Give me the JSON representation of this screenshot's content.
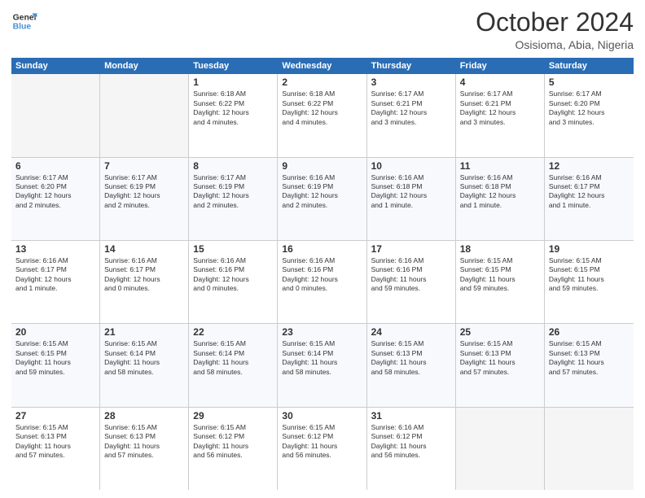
{
  "header": {
    "logo_line1": "General",
    "logo_line2": "Blue",
    "month": "October 2024",
    "location": "Osisioma, Abia, Nigeria"
  },
  "weekdays": [
    "Sunday",
    "Monday",
    "Tuesday",
    "Wednesday",
    "Thursday",
    "Friday",
    "Saturday"
  ],
  "rows": [
    [
      {
        "day": "",
        "info": "",
        "empty": true
      },
      {
        "day": "",
        "info": "",
        "empty": true
      },
      {
        "day": "1",
        "info": "Sunrise: 6:18 AM\nSunset: 6:22 PM\nDaylight: 12 hours\nand 4 minutes."
      },
      {
        "day": "2",
        "info": "Sunrise: 6:18 AM\nSunset: 6:22 PM\nDaylight: 12 hours\nand 4 minutes."
      },
      {
        "day": "3",
        "info": "Sunrise: 6:17 AM\nSunset: 6:21 PM\nDaylight: 12 hours\nand 3 minutes."
      },
      {
        "day": "4",
        "info": "Sunrise: 6:17 AM\nSunset: 6:21 PM\nDaylight: 12 hours\nand 3 minutes."
      },
      {
        "day": "5",
        "info": "Sunrise: 6:17 AM\nSunset: 6:20 PM\nDaylight: 12 hours\nand 3 minutes."
      }
    ],
    [
      {
        "day": "6",
        "info": "Sunrise: 6:17 AM\nSunset: 6:20 PM\nDaylight: 12 hours\nand 2 minutes."
      },
      {
        "day": "7",
        "info": "Sunrise: 6:17 AM\nSunset: 6:19 PM\nDaylight: 12 hours\nand 2 minutes."
      },
      {
        "day": "8",
        "info": "Sunrise: 6:17 AM\nSunset: 6:19 PM\nDaylight: 12 hours\nand 2 minutes."
      },
      {
        "day": "9",
        "info": "Sunrise: 6:16 AM\nSunset: 6:19 PM\nDaylight: 12 hours\nand 2 minutes."
      },
      {
        "day": "10",
        "info": "Sunrise: 6:16 AM\nSunset: 6:18 PM\nDaylight: 12 hours\nand 1 minute."
      },
      {
        "day": "11",
        "info": "Sunrise: 6:16 AM\nSunset: 6:18 PM\nDaylight: 12 hours\nand 1 minute."
      },
      {
        "day": "12",
        "info": "Sunrise: 6:16 AM\nSunset: 6:17 PM\nDaylight: 12 hours\nand 1 minute."
      }
    ],
    [
      {
        "day": "13",
        "info": "Sunrise: 6:16 AM\nSunset: 6:17 PM\nDaylight: 12 hours\nand 1 minute."
      },
      {
        "day": "14",
        "info": "Sunrise: 6:16 AM\nSunset: 6:17 PM\nDaylight: 12 hours\nand 0 minutes."
      },
      {
        "day": "15",
        "info": "Sunrise: 6:16 AM\nSunset: 6:16 PM\nDaylight: 12 hours\nand 0 minutes."
      },
      {
        "day": "16",
        "info": "Sunrise: 6:16 AM\nSunset: 6:16 PM\nDaylight: 12 hours\nand 0 minutes."
      },
      {
        "day": "17",
        "info": "Sunrise: 6:16 AM\nSunset: 6:16 PM\nDaylight: 11 hours\nand 59 minutes."
      },
      {
        "day": "18",
        "info": "Sunrise: 6:15 AM\nSunset: 6:15 PM\nDaylight: 11 hours\nand 59 minutes."
      },
      {
        "day": "19",
        "info": "Sunrise: 6:15 AM\nSunset: 6:15 PM\nDaylight: 11 hours\nand 59 minutes."
      }
    ],
    [
      {
        "day": "20",
        "info": "Sunrise: 6:15 AM\nSunset: 6:15 PM\nDaylight: 11 hours\nand 59 minutes."
      },
      {
        "day": "21",
        "info": "Sunrise: 6:15 AM\nSunset: 6:14 PM\nDaylight: 11 hours\nand 58 minutes."
      },
      {
        "day": "22",
        "info": "Sunrise: 6:15 AM\nSunset: 6:14 PM\nDaylight: 11 hours\nand 58 minutes."
      },
      {
        "day": "23",
        "info": "Sunrise: 6:15 AM\nSunset: 6:14 PM\nDaylight: 11 hours\nand 58 minutes."
      },
      {
        "day": "24",
        "info": "Sunrise: 6:15 AM\nSunset: 6:13 PM\nDaylight: 11 hours\nand 58 minutes."
      },
      {
        "day": "25",
        "info": "Sunrise: 6:15 AM\nSunset: 6:13 PM\nDaylight: 11 hours\nand 57 minutes."
      },
      {
        "day": "26",
        "info": "Sunrise: 6:15 AM\nSunset: 6:13 PM\nDaylight: 11 hours\nand 57 minutes."
      }
    ],
    [
      {
        "day": "27",
        "info": "Sunrise: 6:15 AM\nSunset: 6:13 PM\nDaylight: 11 hours\nand 57 minutes."
      },
      {
        "day": "28",
        "info": "Sunrise: 6:15 AM\nSunset: 6:13 PM\nDaylight: 11 hours\nand 57 minutes."
      },
      {
        "day": "29",
        "info": "Sunrise: 6:15 AM\nSunset: 6:12 PM\nDaylight: 11 hours\nand 56 minutes."
      },
      {
        "day": "30",
        "info": "Sunrise: 6:15 AM\nSunset: 6:12 PM\nDaylight: 11 hours\nand 56 minutes."
      },
      {
        "day": "31",
        "info": "Sunrise: 6:16 AM\nSunset: 6:12 PM\nDaylight: 11 hours\nand 56 minutes."
      },
      {
        "day": "",
        "info": "",
        "empty": true
      },
      {
        "day": "",
        "info": "",
        "empty": true
      }
    ]
  ]
}
